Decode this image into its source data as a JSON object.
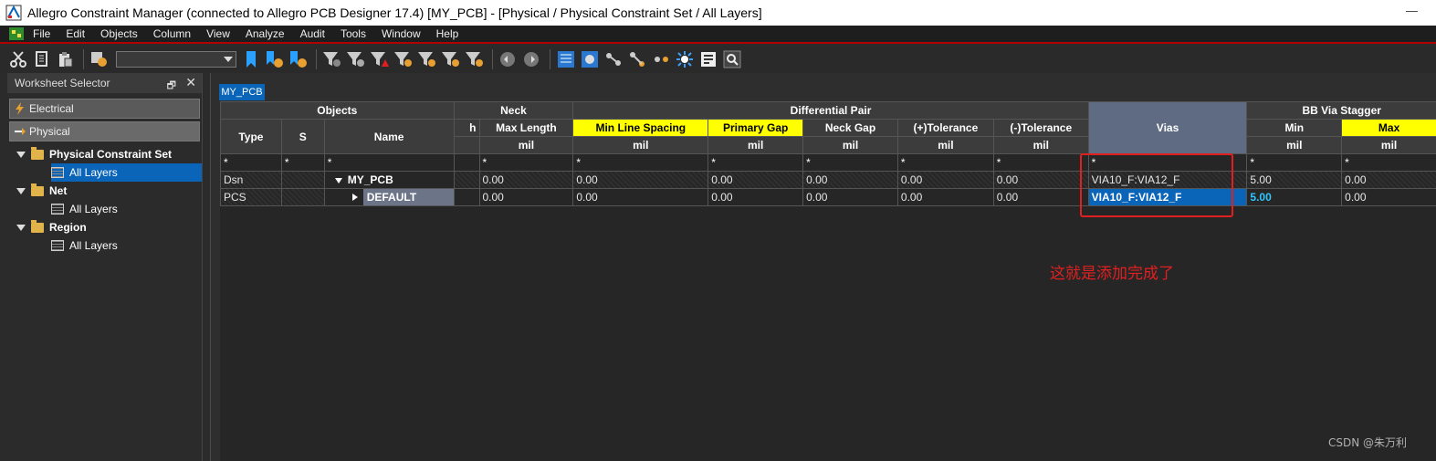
{
  "window": {
    "title": "Allegro Constraint Manager (connected to Allegro PCB Designer 17.4) [MY_PCB] - [Physical / Physical Constraint Set / All Layers]",
    "minimize": "—"
  },
  "menu": [
    "File",
    "Edit",
    "Objects",
    "Column",
    "View",
    "Analyze",
    "Audit",
    "Tools",
    "Window",
    "Help"
  ],
  "toolbar": {
    "combo_value": ""
  },
  "worksheet_selector": {
    "title": "Worksheet Selector",
    "pin": "🗗",
    "close": "✕",
    "electrical": "Electrical",
    "physical": "Physical",
    "tree": [
      {
        "label": "Physical Constraint Set",
        "child": "All Layers",
        "selected": true
      },
      {
        "label": "Net",
        "child": "All Layers"
      },
      {
        "label": "Region",
        "child": "All Layers"
      }
    ]
  },
  "doc_tab": "MY_PCB",
  "sheet": {
    "groups": {
      "objects": "Objects",
      "neck": "Neck",
      "diff_pair": "Differential Pair",
      "bb_via": "BB Via Stagger"
    },
    "cols": {
      "type": "Type",
      "s": "S",
      "name": "Name",
      "neck_cut": "h",
      "max_length": "Max Length",
      "min_line_spacing": "Min Line Spacing",
      "primary_gap": "Primary Gap",
      "neck_gap": "Neck Gap",
      "plus_tol": "(+)Tolerance",
      "minus_tol": "(-)Tolerance",
      "vias": "Vias",
      "min": "Min",
      "max": "Max"
    },
    "unit": "mil",
    "star": "*",
    "rows": [
      {
        "type": "Dsn",
        "name": "MY_PCB",
        "max_length": "0.00",
        "min_line_spacing": "0.00",
        "primary_gap": "0.00",
        "neck_gap": "0.00",
        "plus_tol": "0.00",
        "minus_tol": "0.00",
        "vias": "VIA10_F:VIA12_F",
        "min": "5.00",
        "max": "0.00"
      },
      {
        "type": "PCS",
        "name": "DEFAULT",
        "max_length": "0.00",
        "min_line_spacing": "0.00",
        "primary_gap": "0.00",
        "neck_gap": "0.00",
        "plus_tol": "0.00",
        "minus_tol": "0.00",
        "vias": "VIA10_F:VIA12_F",
        "min": "5.00",
        "max": "0.00"
      }
    ]
  },
  "annotation": "这就是添加完成了",
  "watermark": "CSDN @朱万利"
}
